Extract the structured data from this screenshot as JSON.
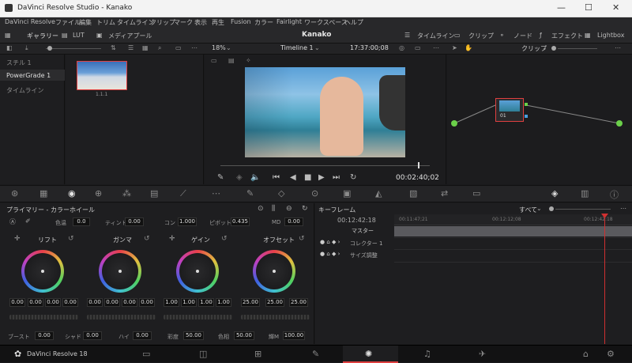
{
  "window": {
    "title": "DaVinci Resolve Studio - Kanako",
    "min": "—",
    "max": "☐",
    "close": "✕"
  },
  "menu": [
    "DaVinci Resolve",
    "ファイル",
    "編集",
    "トリム",
    "タイムライン",
    "クリップ",
    "マーク",
    "表示",
    "再生",
    "Fusion",
    "カラー",
    "Fairlight",
    "ワークスペース",
    "ヘルプ"
  ],
  "pagebar": {
    "gallery": "ギャラリー",
    "lut": "LUT",
    "media": "メディアプール",
    "project": "Kanako",
    "timeline": "タイムライン",
    "clip": "クリップ",
    "node": "ノード",
    "effect": "エフェクト",
    "lightbox": "Lightbox"
  },
  "toolbar": {
    "zoom": "18%",
    "timeline": "Timeline 1",
    "timecode": "17:37:00;08",
    "clip_mode": "クリップ"
  },
  "gallery": {
    "items": [
      "スチル 1",
      "PowerGrade 1",
      "タイムライン"
    ],
    "still_label": "1.1.1"
  },
  "viewer": {
    "timecode": "00:02:40;02"
  },
  "nodes": {
    "node_label": "01"
  },
  "colorwheels": {
    "title": "プライマリー - カラーホイール",
    "temp_label": "色温",
    "temp": "0.0",
    "tint_label": "ティント",
    "tint": "0.00",
    "contrast_label": "コン",
    "contrast": "1.000",
    "pivot_label": "ピボット",
    "pivot": "0.435",
    "md_label": "MD",
    "md": "0.00",
    "wheels": [
      {
        "name": "リフト",
        "values": [
          "0.00",
          "0.00",
          "0.00",
          "0.00"
        ]
      },
      {
        "name": "ガンマ",
        "values": [
          "0.00",
          "0.00",
          "0.00",
          "0.00"
        ]
      },
      {
        "name": "ゲイン",
        "values": [
          "1.00",
          "1.00",
          "1.00",
          "1.00"
        ]
      },
      {
        "name": "オフセット",
        "values": [
          "25.00",
          "25.00",
          "25.00"
        ]
      }
    ],
    "bottom": [
      {
        "label": "ブースト",
        "value": "0.00"
      },
      {
        "label": "シャド",
        "value": "0.00"
      },
      {
        "label": "ハイ",
        "value": "0.00"
      },
      {
        "label": "彩度",
        "value": "50.00"
      },
      {
        "label": "色相",
        "value": "50.00"
      },
      {
        "label": "輝M",
        "value": "100.00"
      }
    ]
  },
  "keyframes": {
    "title": "キーフレーム",
    "filter": "すべて",
    "timecode": "00:12:42:18",
    "ruler": [
      "00:11:47;21",
      "00:12:12;08",
      "00:12:42:18"
    ],
    "tracks": [
      "マスター",
      "コレクター 1",
      "サイズ調整"
    ]
  },
  "bottom": {
    "app": "DaVinci Resolve 18"
  }
}
